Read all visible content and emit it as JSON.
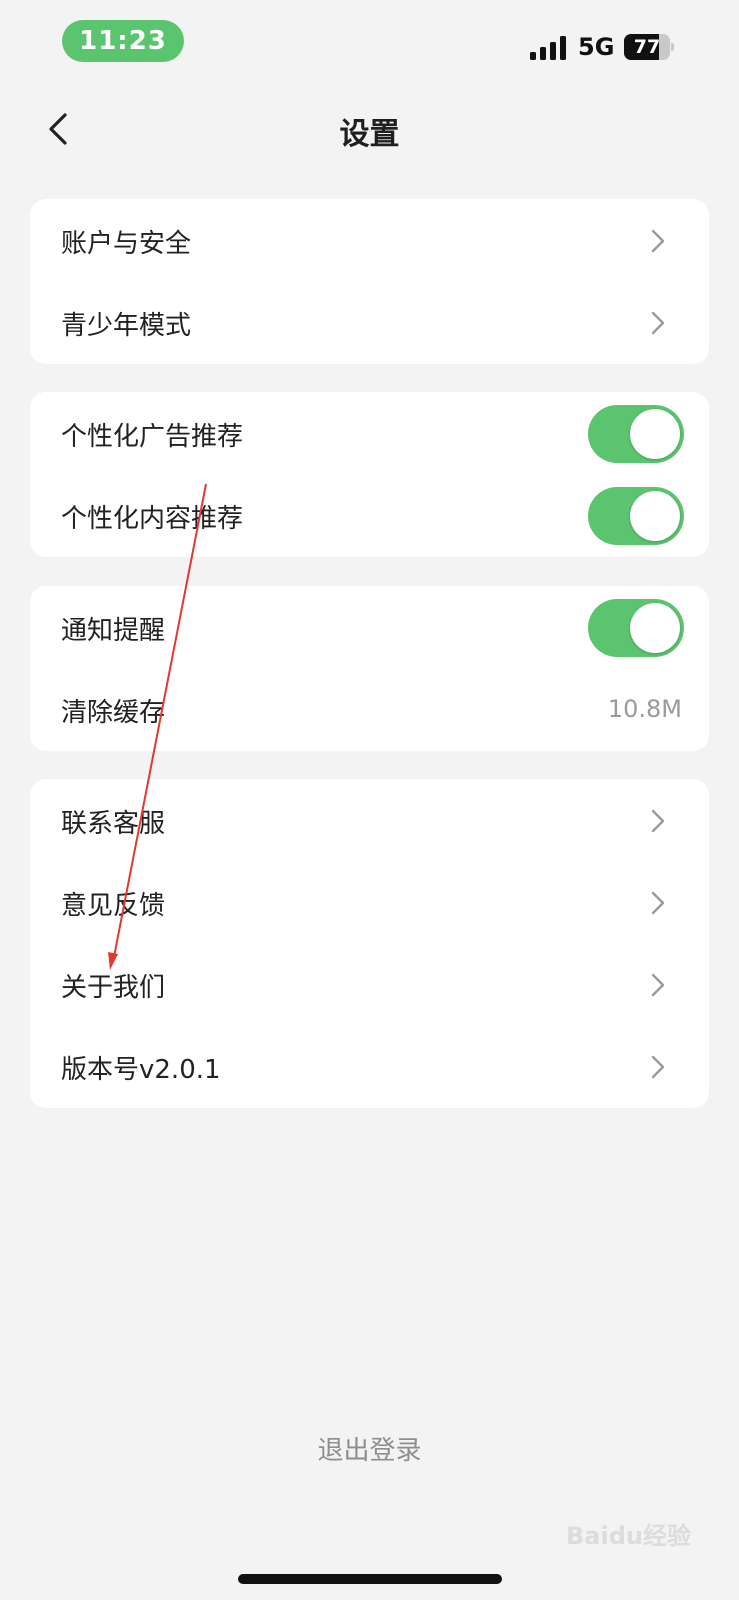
{
  "status_bar": {
    "time": "11:23",
    "network": "5G",
    "battery_percent": "77",
    "battery_level": 0.77
  },
  "nav": {
    "title": "设置",
    "back_icon": "chevron-left-icon"
  },
  "sections": {
    "account": {
      "items": [
        {
          "label": "账户与安全",
          "icon": "chevron-right-icon"
        },
        {
          "label": "青少年模式",
          "icon": "chevron-right-icon"
        }
      ]
    },
    "personalization": {
      "items": [
        {
          "label": "个性化广告推荐",
          "toggle_on": true
        },
        {
          "label": "个性化内容推荐",
          "toggle_on": true
        }
      ]
    },
    "notification": {
      "items": [
        {
          "label": "通知提醒",
          "toggle_on": true
        },
        {
          "label": "清除缓存",
          "value": "10.8M"
        }
      ]
    },
    "about": {
      "items": [
        {
          "label": "联系客服",
          "icon": "chevron-right-icon"
        },
        {
          "label": "意见反馈",
          "icon": "chevron-right-icon"
        },
        {
          "label": "关于我们",
          "icon": "chevron-right-icon"
        },
        {
          "label": "版本号v2.0.1",
          "icon": "chevron-right-icon"
        }
      ]
    }
  },
  "logout_label": "退出登录",
  "watermark": "Baidu经验",
  "colors": {
    "accent_green": "#5bc46f",
    "background": "#f3f3f3",
    "annotation_arrow": "#e03a2e"
  }
}
